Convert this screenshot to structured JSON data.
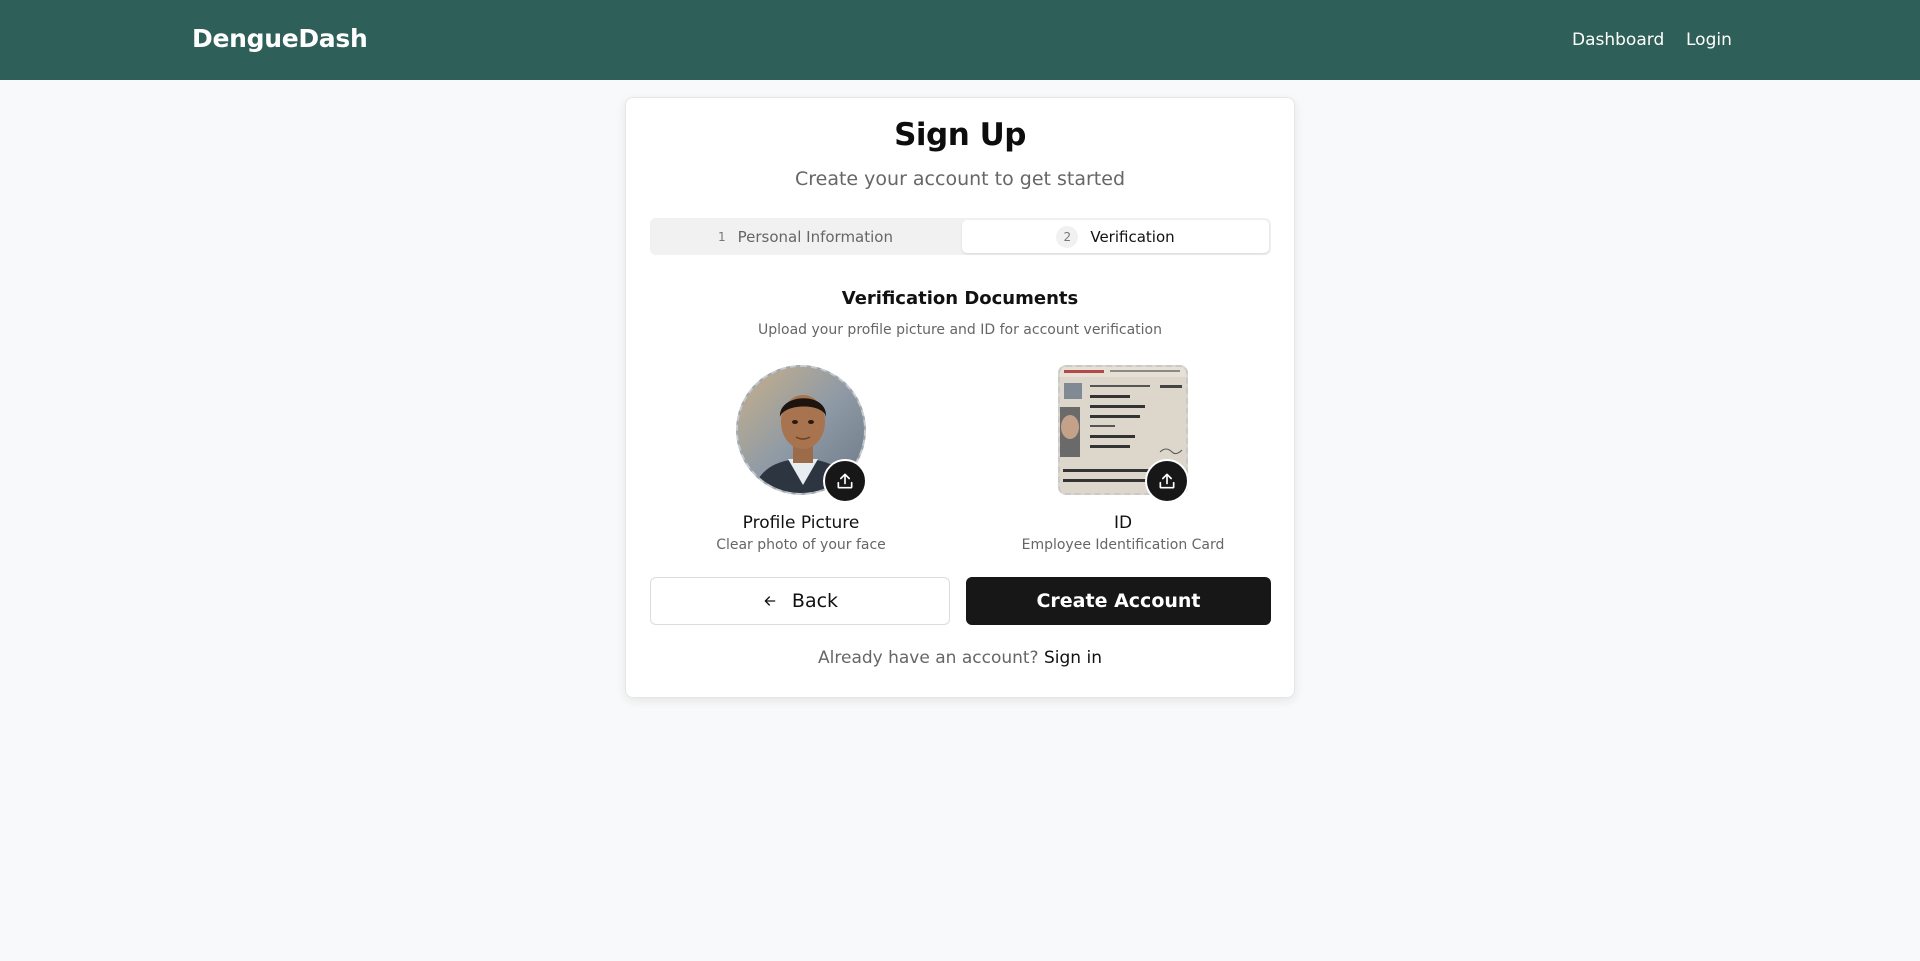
{
  "app": {
    "brand": "DengueDash"
  },
  "nav": {
    "dashboard": "Dashboard",
    "login": "Login"
  },
  "form": {
    "title": "Sign Up",
    "subtitle": "Create your account to get started",
    "steps": [
      {
        "number": "1",
        "label": "Personal Information",
        "active": false
      },
      {
        "number": "2",
        "label": "Verification",
        "active": true
      }
    ],
    "section_title": "Verification Documents",
    "section_desc": "Upload your profile picture and ID for account verification",
    "profile": {
      "label": "Profile Picture",
      "hint": "Clear photo of your face"
    },
    "id": {
      "label": "ID",
      "hint": "Employee Identification Card"
    },
    "back_label": "Back",
    "create_label": "Create Account",
    "signin_prompt": "Already have an account?",
    "signin_link": "Sign in"
  },
  "colors": {
    "header_bg": "#2f5f59",
    "primary_button": "#171717",
    "page_bg": "#f8f9fa"
  },
  "icons": [
    "arrow-left-icon",
    "upload-icon"
  ]
}
